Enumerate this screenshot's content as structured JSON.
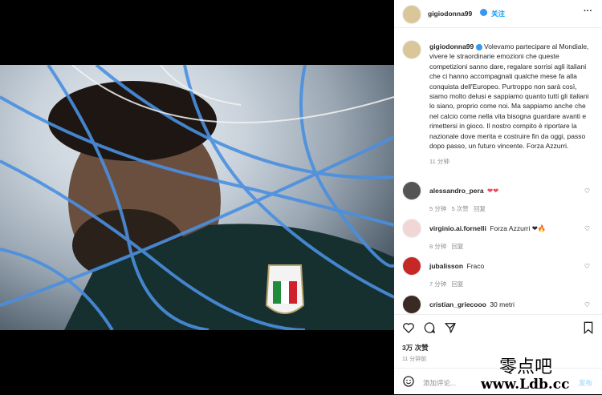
{
  "header": {
    "username": "gigiodonna99",
    "follow": "关注",
    "more": "···"
  },
  "caption": {
    "username": "gigiodonna99",
    "text": "Volevamo partecipare al Mondiale, vivere le straordinarie emozioni che queste competizioni sanno dare, regalare sorrisi agli italiani che ci hanno accompagnati qualche mese fa alla conquista dell'Europeo. Purtroppo non sarà così, siamo molto delusi e sappiamo quanto tutti gli italiani lo siano, proprio come noi. Ma sappiamo anche che nel calcio come nella vita bisogna guardare avanti e rimettersi in gioco. Il nostro compito è riportare la nazionale dove merita e costruire fin da oggi, passo dopo passo, un futuro vincente. Forza Azzurri.",
    "time": "11 分钟"
  },
  "comments": [
    {
      "username": "alessandro_pera",
      "text": "❤❤",
      "time": "5 分钟",
      "likes": "5 次赞",
      "reply": "回复"
    },
    {
      "username": "virginio.ai.fornelli",
      "text": "Forza Azzurri ❤🔥",
      "time": "8 分钟",
      "reply": "回复"
    },
    {
      "username": "jubalisson",
      "text": "Fraco",
      "time": "7 分钟",
      "reply": "回复"
    },
    {
      "username": "cristian_griecooo",
      "text": "30 metri"
    }
  ],
  "stats": {
    "likes": "3万 次赞",
    "time": "11 分钟前"
  },
  "add_comment": {
    "placeholder": "添加评论...",
    "post": "发布"
  },
  "watermark": {
    "line1": "零点吧",
    "line2": "www.Ldb.cc"
  },
  "colors": {
    "accent": "#0095f6",
    "heart": "#ed4956",
    "verified": "#3897f0"
  }
}
